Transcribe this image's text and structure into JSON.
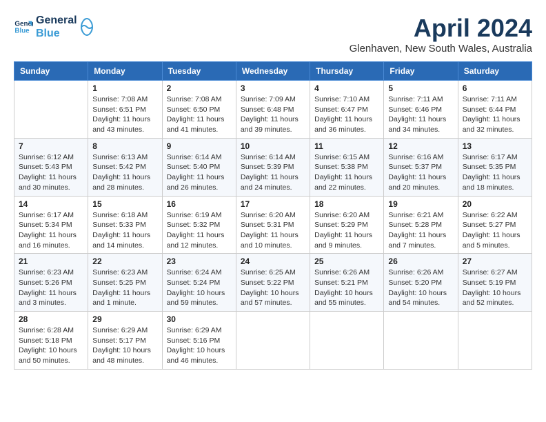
{
  "header": {
    "logo_line1": "General",
    "logo_line2": "Blue",
    "month_title": "April 2024",
    "location": "Glenhaven, New South Wales, Australia"
  },
  "days_of_week": [
    "Sunday",
    "Monday",
    "Tuesday",
    "Wednesday",
    "Thursday",
    "Friday",
    "Saturday"
  ],
  "weeks": [
    [
      {
        "day": "",
        "info": ""
      },
      {
        "day": "1",
        "info": "Sunrise: 7:08 AM\nSunset: 6:51 PM\nDaylight: 11 hours\nand 43 minutes."
      },
      {
        "day": "2",
        "info": "Sunrise: 7:08 AM\nSunset: 6:50 PM\nDaylight: 11 hours\nand 41 minutes."
      },
      {
        "day": "3",
        "info": "Sunrise: 7:09 AM\nSunset: 6:48 PM\nDaylight: 11 hours\nand 39 minutes."
      },
      {
        "day": "4",
        "info": "Sunrise: 7:10 AM\nSunset: 6:47 PM\nDaylight: 11 hours\nand 36 minutes."
      },
      {
        "day": "5",
        "info": "Sunrise: 7:11 AM\nSunset: 6:46 PM\nDaylight: 11 hours\nand 34 minutes."
      },
      {
        "day": "6",
        "info": "Sunrise: 7:11 AM\nSunset: 6:44 PM\nDaylight: 11 hours\nand 32 minutes."
      }
    ],
    [
      {
        "day": "7",
        "info": "Sunrise: 6:12 AM\nSunset: 5:43 PM\nDaylight: 11 hours\nand 30 minutes."
      },
      {
        "day": "8",
        "info": "Sunrise: 6:13 AM\nSunset: 5:42 PM\nDaylight: 11 hours\nand 28 minutes."
      },
      {
        "day": "9",
        "info": "Sunrise: 6:14 AM\nSunset: 5:40 PM\nDaylight: 11 hours\nand 26 minutes."
      },
      {
        "day": "10",
        "info": "Sunrise: 6:14 AM\nSunset: 5:39 PM\nDaylight: 11 hours\nand 24 minutes."
      },
      {
        "day": "11",
        "info": "Sunrise: 6:15 AM\nSunset: 5:38 PM\nDaylight: 11 hours\nand 22 minutes."
      },
      {
        "day": "12",
        "info": "Sunrise: 6:16 AM\nSunset: 5:37 PM\nDaylight: 11 hours\nand 20 minutes."
      },
      {
        "day": "13",
        "info": "Sunrise: 6:17 AM\nSunset: 5:35 PM\nDaylight: 11 hours\nand 18 minutes."
      }
    ],
    [
      {
        "day": "14",
        "info": "Sunrise: 6:17 AM\nSunset: 5:34 PM\nDaylight: 11 hours\nand 16 minutes."
      },
      {
        "day": "15",
        "info": "Sunrise: 6:18 AM\nSunset: 5:33 PM\nDaylight: 11 hours\nand 14 minutes."
      },
      {
        "day": "16",
        "info": "Sunrise: 6:19 AM\nSunset: 5:32 PM\nDaylight: 11 hours\nand 12 minutes."
      },
      {
        "day": "17",
        "info": "Sunrise: 6:20 AM\nSunset: 5:31 PM\nDaylight: 11 hours\nand 10 minutes."
      },
      {
        "day": "18",
        "info": "Sunrise: 6:20 AM\nSunset: 5:29 PM\nDaylight: 11 hours\nand 9 minutes."
      },
      {
        "day": "19",
        "info": "Sunrise: 6:21 AM\nSunset: 5:28 PM\nDaylight: 11 hours\nand 7 minutes."
      },
      {
        "day": "20",
        "info": "Sunrise: 6:22 AM\nSunset: 5:27 PM\nDaylight: 11 hours\nand 5 minutes."
      }
    ],
    [
      {
        "day": "21",
        "info": "Sunrise: 6:23 AM\nSunset: 5:26 PM\nDaylight: 11 hours\nand 3 minutes."
      },
      {
        "day": "22",
        "info": "Sunrise: 6:23 AM\nSunset: 5:25 PM\nDaylight: 11 hours\nand 1 minute."
      },
      {
        "day": "23",
        "info": "Sunrise: 6:24 AM\nSunset: 5:24 PM\nDaylight: 10 hours\nand 59 minutes."
      },
      {
        "day": "24",
        "info": "Sunrise: 6:25 AM\nSunset: 5:22 PM\nDaylight: 10 hours\nand 57 minutes."
      },
      {
        "day": "25",
        "info": "Sunrise: 6:26 AM\nSunset: 5:21 PM\nDaylight: 10 hours\nand 55 minutes."
      },
      {
        "day": "26",
        "info": "Sunrise: 6:26 AM\nSunset: 5:20 PM\nDaylight: 10 hours\nand 54 minutes."
      },
      {
        "day": "27",
        "info": "Sunrise: 6:27 AM\nSunset: 5:19 PM\nDaylight: 10 hours\nand 52 minutes."
      }
    ],
    [
      {
        "day": "28",
        "info": "Sunrise: 6:28 AM\nSunset: 5:18 PM\nDaylight: 10 hours\nand 50 minutes."
      },
      {
        "day": "29",
        "info": "Sunrise: 6:29 AM\nSunset: 5:17 PM\nDaylight: 10 hours\nand 48 minutes."
      },
      {
        "day": "30",
        "info": "Sunrise: 6:29 AM\nSunset: 5:16 PM\nDaylight: 10 hours\nand 46 minutes."
      },
      {
        "day": "",
        "info": ""
      },
      {
        "day": "",
        "info": ""
      },
      {
        "day": "",
        "info": ""
      },
      {
        "day": "",
        "info": ""
      }
    ]
  ]
}
